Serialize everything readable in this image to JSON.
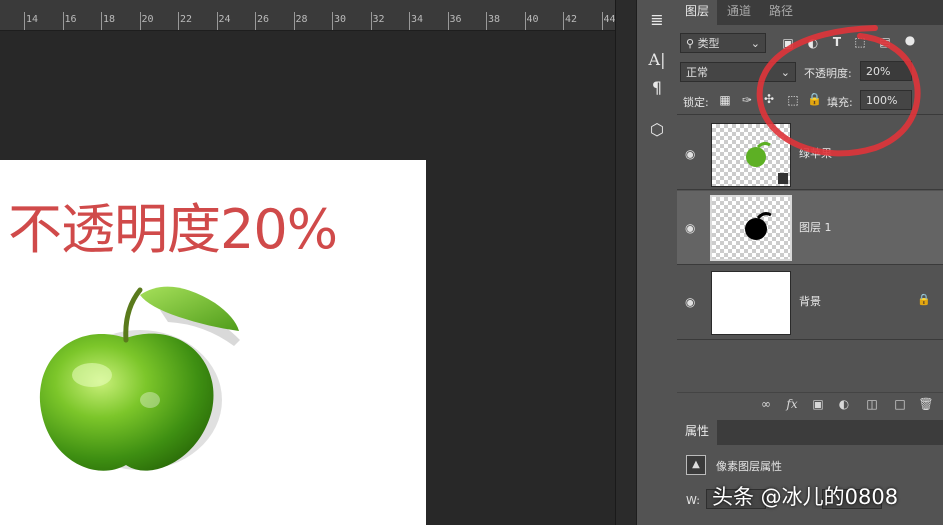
{
  "ruler": {
    "labels": [
      "14",
      "16",
      "18",
      "20",
      "22",
      "24",
      "26",
      "28",
      "30",
      "32",
      "34",
      "36",
      "38",
      "40",
      "42",
      "44"
    ]
  },
  "canvas": {
    "caption": "不透明度20%",
    "caption_color": "#d04a4a"
  },
  "tools": [
    "paragraph-align-icon",
    "character-icon",
    "paragraph-icon",
    "3d-cube-icon"
  ],
  "layers_panel": {
    "tabs": [
      {
        "label": "图层",
        "active": true
      },
      {
        "label": "通道",
        "active": false
      },
      {
        "label": "路径",
        "active": false
      }
    ],
    "filter_kind": "类型",
    "blend_mode": "正常",
    "opacity_label": "不透明度:",
    "opacity_value": "20%",
    "lock_label": "锁定:",
    "fill_label": "填充:",
    "fill_value": "100%",
    "layers": [
      {
        "name": "绿苹果",
        "visible": true,
        "selected": false
      },
      {
        "name": "图层 1",
        "visible": true,
        "selected": true
      },
      {
        "name": "背景",
        "visible": true,
        "selected": false,
        "locked": true
      }
    ]
  },
  "properties_panel": {
    "tab": "属性",
    "title": "像素图层属性",
    "w_label": "W:"
  },
  "watermark": "头条 @冰儿的0808",
  "accent_annotation_color": "#e0343a"
}
